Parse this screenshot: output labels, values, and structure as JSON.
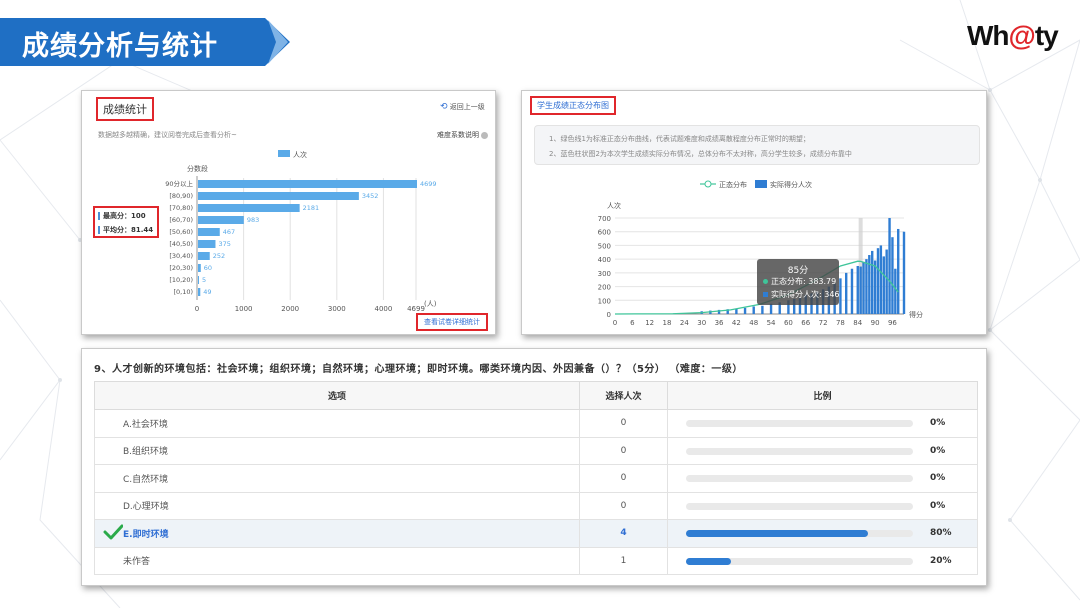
{
  "header": {
    "title": "成绩分析与统计",
    "logo_text_left": "Wh",
    "logo_text_at": "@",
    "logo_text_right": "ty"
  },
  "score_stats": {
    "tab_label": "成绩统计",
    "back_label": "返回上一级",
    "hint": "数据越多越精确，建议阅卷完成后查看分析~",
    "difficulty_label": "难度系数说明",
    "legend": "人次",
    "axis_title": "分数段",
    "x_unit": "(人)",
    "max_score_label": "最高分：100",
    "avg_score_label": "平均分：81.44",
    "detail_button": "查看试卷详细统计"
  },
  "distribution": {
    "tab_label": "学生成绩正态分布图",
    "note_1": "1、绿色线1为标准正态分布曲线，代表试题难度和成绩离散程度分布正常时的期望；",
    "note_2": "2、蓝色柱状图2为本次学生成绩实际分布情况，总体分布不太对称，高分学生较多，成绩分布靠中",
    "legend_normal": "正态分布",
    "legend_actual": "实际得分人次",
    "y_label": "人次",
    "x_label": "得分",
    "tooltip_title": "85分",
    "tooltip_normal": "正态分布: 383.79",
    "tooltip_actual": "实际得分人次: 346"
  },
  "question": {
    "title": "9、人才创新的环境包括：社会环境；组织环境；自然环境；心理环境；即时环境。哪类环境内因、外因兼备（）？（5分）     （难度：一级）",
    "headers": [
      "选项",
      "选择人次",
      "比例"
    ],
    "rows": [
      {
        "option": "A.社会环境",
        "count": "0",
        "percent": "0%",
        "ratio": 0
      },
      {
        "option": "B.组织环境",
        "count": "0",
        "percent": "0%",
        "ratio": 0
      },
      {
        "option": "C.自然环境",
        "count": "0",
        "percent": "0%",
        "ratio": 0
      },
      {
        "option": "D.心理环境",
        "count": "0",
        "percent": "0%",
        "ratio": 0
      },
      {
        "option": "E.即时环境",
        "count": "4",
        "percent": "80%",
        "ratio": 0.8,
        "correct": true
      },
      {
        "option": "未作答",
        "count": "1",
        "percent": "20%",
        "ratio": 0.2
      }
    ]
  },
  "colors": {
    "banner": "#1f6fc4",
    "bar": "#5aaae8",
    "hist_bar": "#2f7dd3",
    "normal_curve": "#3fc59a",
    "highlight": "#e0262b",
    "check": "#2aaa4a"
  },
  "chart_data": [
    {
      "type": "bar",
      "orientation": "horizontal",
      "categories": [
        "90分以上",
        "[80,90)",
        "[70,80)",
        "[60,70)",
        "[50,60)",
        "[40,50)",
        "[30,40)",
        "[20,30)",
        "[10,20)",
        "[0,10)"
      ],
      "values": [
        4699,
        3452,
        2181,
        983,
        467,
        375,
        252,
        60,
        5,
        49
      ],
      "xticks": [
        "0",
        "1000",
        "2000",
        "3000",
        "4000",
        "4699"
      ],
      "xlim": [
        0,
        4699
      ],
      "legend": [
        "人次"
      ],
      "ylabel": "分数段",
      "xlabel": "(人)"
    },
    {
      "type": "bar",
      "title": "学生成绩正态分布图",
      "x": [
        0,
        6,
        12,
        18,
        24,
        30,
        36,
        42,
        48,
        54,
        60,
        66,
        72,
        78,
        84,
        90,
        96
      ],
      "yticks": [
        0,
        100,
        200,
        300,
        400,
        500,
        600,
        700
      ],
      "ylim": [
        0,
        700
      ],
      "xlim": [
        0,
        100
      ],
      "xlabel": "得分",
      "ylabel": "人次",
      "series": [
        {
          "name": "实际得分人次",
          "points": [
            [
              30,
              20
            ],
            [
              33,
              25
            ],
            [
              36,
              30
            ],
            [
              39,
              35
            ],
            [
              42,
              40
            ],
            [
              45,
              45
            ],
            [
              48,
              55
            ],
            [
              51,
              60
            ],
            [
              54,
              75
            ],
            [
              57,
              85
            ],
            [
              60,
              100
            ],
            [
              62,
              110
            ],
            [
              64,
              120
            ],
            [
              66,
              140
            ],
            [
              68,
              150
            ],
            [
              70,
              165
            ],
            [
              72,
              180
            ],
            [
              74,
              200
            ],
            [
              76,
              220
            ],
            [
              78,
              260
            ],
            [
              80,
              300
            ],
            [
              82,
              330
            ],
            [
              84,
              350
            ],
            [
              85,
              346
            ],
            [
              86,
              380
            ],
            [
              87,
              400
            ],
            [
              88,
              430
            ],
            [
              89,
              460
            ],
            [
              90,
              390
            ],
            [
              91,
              480
            ],
            [
              92,
              500
            ],
            [
              93,
              420
            ],
            [
              94,
              470
            ],
            [
              95,
              700
            ],
            [
              96,
              560
            ],
            [
              97,
              330
            ],
            [
              98,
              620
            ],
            [
              100,
              600
            ]
          ]
        },
        {
          "name": "正态分布",
          "points": [
            [
              0,
              0
            ],
            [
              20,
              2
            ],
            [
              30,
              10
            ],
            [
              40,
              30
            ],
            [
              50,
              70
            ],
            [
              60,
              140
            ],
            [
              70,
              250
            ],
            [
              78,
              350
            ],
            [
              84,
              385
            ],
            [
              85,
              383.79
            ],
            [
              90,
              350
            ],
            [
              95,
              240
            ],
            [
              98,
              160
            ]
          ]
        }
      ],
      "legend": "top-center"
    }
  ]
}
